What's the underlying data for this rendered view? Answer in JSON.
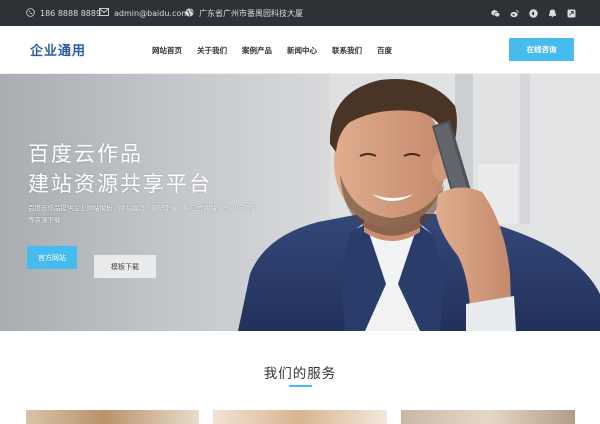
{
  "topbar": {
    "phone": "186 8888 8889",
    "email": "admin@baidu.com",
    "address": "广东省广州市番禺园科技大厦",
    "social": [
      "wechat-icon",
      "weibo-icon",
      "qq-icon",
      "penguin-icon",
      "share-icon"
    ]
  },
  "header": {
    "logo": "企业通用",
    "nav": [
      "网站首页",
      "关于我们",
      "案例产品",
      "新闻中心",
      "联系我们",
      "百度"
    ],
    "cta": "在线咨询"
  },
  "hero": {
    "title_line1": "百度云作品",
    "title_line2": "建站资源共享平台",
    "description": "百度云作品提供企业网站模板、网站建设、源码下载、响应式网站、Html5网站等资源下载",
    "button_primary": "官方网站",
    "button_secondary": "模板下载"
  },
  "services": {
    "title": "我们的服务"
  },
  "colors": {
    "accent": "#46bbee",
    "topbar_bg": "#2e3136",
    "logo": "#2a5ba6",
    "suit": "#2c3d66"
  }
}
